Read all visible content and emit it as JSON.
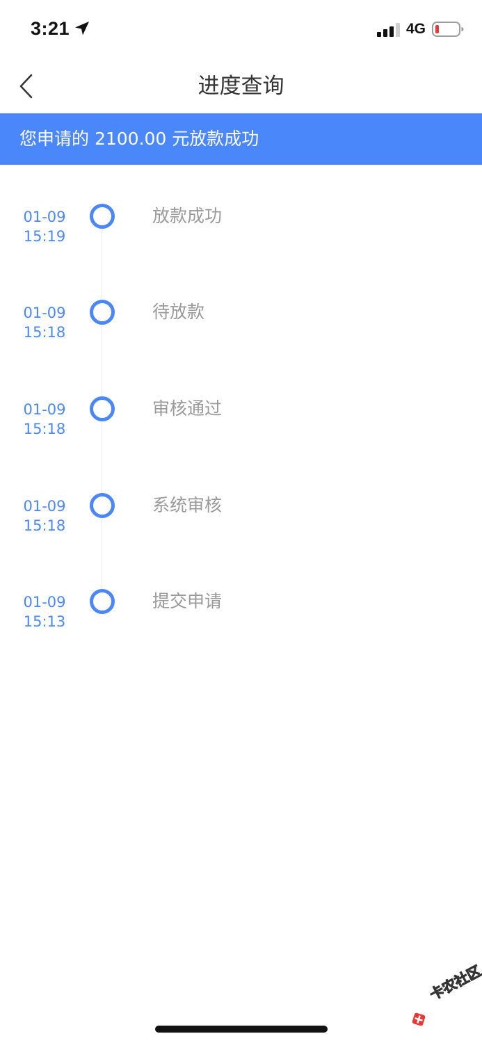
{
  "status_bar": {
    "time": "3:21",
    "network": "4G",
    "icons": {
      "location": "location-arrow-icon",
      "signal": "cellular-signal-icon",
      "battery": "battery-low-icon"
    },
    "battery_color": "#e53935"
  },
  "nav": {
    "back_icon": "chevron-left-icon",
    "title": "进度查询"
  },
  "banner": {
    "text": "您申请的 2100.00 元放款成功",
    "color": "#4a87fb"
  },
  "timeline": {
    "accent_color": "#4a87fb",
    "items": [
      {
        "date": "01-09",
        "time": "15:19",
        "label": "放款成功"
      },
      {
        "date": "01-09",
        "time": "15:18",
        "label": "待放款"
      },
      {
        "date": "01-09",
        "time": "15:18",
        "label": "审核通过"
      },
      {
        "date": "01-09",
        "time": "15:18",
        "label": "系统审核"
      },
      {
        "date": "01-09",
        "time": "15:13",
        "label": "提交申请"
      }
    ]
  },
  "watermark": {
    "text": "卡农社区"
  }
}
